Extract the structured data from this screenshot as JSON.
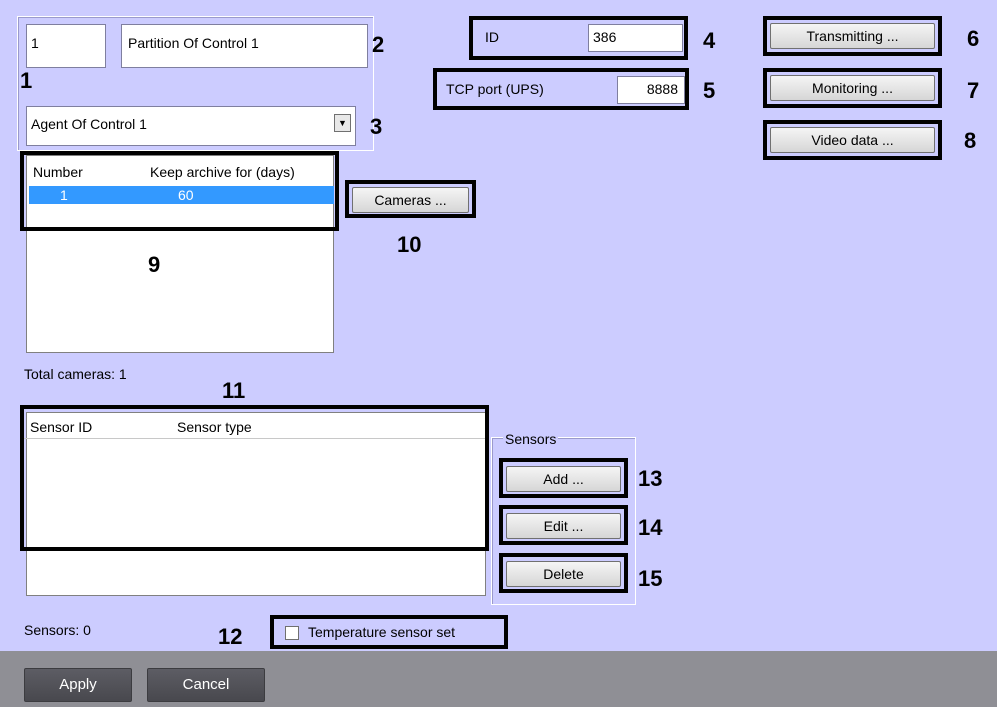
{
  "partition": {
    "number_value": "1",
    "name_value": "Partition Of Control 1",
    "agent_select_value": "Agent Of Control 1"
  },
  "id_field": {
    "label": "ID",
    "value": "386"
  },
  "tcp_field": {
    "label": "TCP port (UPS)",
    "value": "8888"
  },
  "buttons": {
    "transmitting": "Transmitting ...",
    "monitoring": "Monitoring ...",
    "video_data": "Video data ...",
    "cameras": "Cameras ...",
    "add": "Add ...",
    "edit": "Edit ...",
    "delete": "Delete",
    "apply": "Apply",
    "cancel": "Cancel"
  },
  "archive_table": {
    "columns": [
      "Number",
      "Keep archive for (days)"
    ],
    "rows": [
      {
        "number": "1",
        "days": "60"
      }
    ]
  },
  "total_cameras": "Total cameras: 1",
  "sensors_table": {
    "columns": [
      "Sensor ID",
      "Sensor type"
    ]
  },
  "sensors_group_label": "Sensors",
  "sensors_count": "Sensors: 0",
  "temperature_checkbox": {
    "label": "Temperature sensor set",
    "checked": false
  },
  "callouts": [
    "1",
    "2",
    "3",
    "4",
    "5",
    "6",
    "7",
    "8",
    "9",
    "10",
    "11",
    "12",
    "13",
    "14",
    "15"
  ],
  "colors": {
    "background": "#ccccff",
    "selection": "#3399ff",
    "highlight_border": "#000000"
  },
  "icons": [
    "dropdown-arrow-icon",
    "checkbox-icon"
  ]
}
